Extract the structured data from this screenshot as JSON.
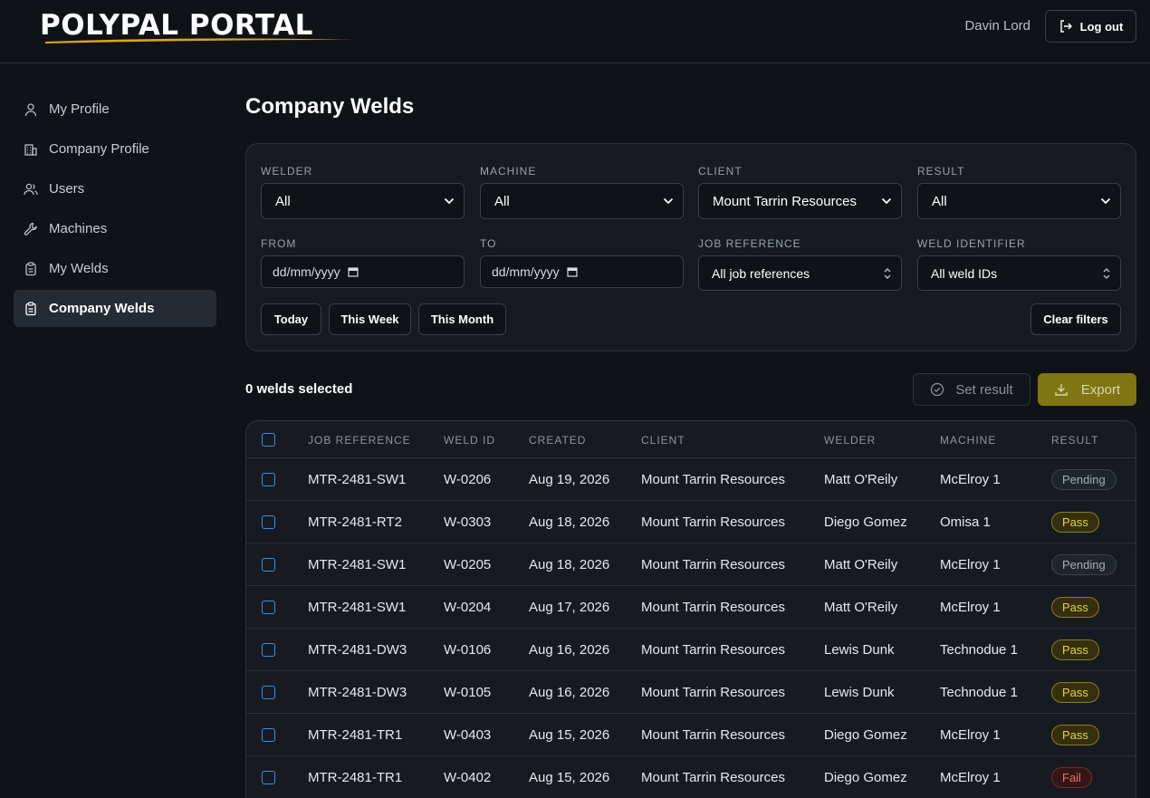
{
  "header": {
    "logo_text": "POLYPAL PORTAL",
    "user_name": "Davin Lord",
    "logout_label": "Log out"
  },
  "sidebar": {
    "items": [
      {
        "label": "My Profile",
        "icon": "user-icon",
        "active": false
      },
      {
        "label": "Company Profile",
        "icon": "building-icon",
        "active": false
      },
      {
        "label": "Users",
        "icon": "users-icon",
        "active": false
      },
      {
        "label": "Machines",
        "icon": "wrench-icon",
        "active": false
      },
      {
        "label": "My Welds",
        "icon": "clipboard-icon",
        "active": false
      },
      {
        "label": "Company Welds",
        "icon": "clipboard-icon",
        "active": true
      }
    ]
  },
  "page": {
    "title": "Company Welds"
  },
  "filters": {
    "welder": {
      "label": "WELDER",
      "value": "All"
    },
    "machine": {
      "label": "MACHINE",
      "value": "All"
    },
    "client": {
      "label": "CLIENT",
      "value": "Mount Tarrin Resources"
    },
    "result": {
      "label": "RESULT",
      "value": "All"
    },
    "from": {
      "label": "FROM",
      "placeholder": "dd/mm/yyyy"
    },
    "to": {
      "label": "TO",
      "placeholder": "dd/mm/yyyy"
    },
    "job_reference": {
      "label": "JOB REFERENCE",
      "value": "All job references"
    },
    "weld_identifier": {
      "label": "WELD IDENTIFIER",
      "value": "All weld IDs"
    },
    "quick": {
      "today": "Today",
      "this_week": "This Week",
      "this_month": "This Month"
    },
    "clear_label": "Clear filters"
  },
  "toolbar": {
    "selection_count": "0 welds selected",
    "set_result_label": "Set result",
    "export_label": "Export"
  },
  "table": {
    "columns": [
      "JOB REFERENCE",
      "WELD ID",
      "CREATED",
      "CLIENT",
      "WELDER",
      "MACHINE",
      "RESULT"
    ],
    "rows": [
      {
        "job": "MTR-2481-SW1",
        "weld": "W-0206",
        "created": "Aug 19, 2026",
        "client": "Mount Tarrin Resources",
        "welder": "Matt O'Reily",
        "machine": "McElroy 1",
        "result": "Pending"
      },
      {
        "job": "MTR-2481-RT2",
        "weld": "W-0303",
        "created": "Aug 18, 2026",
        "client": "Mount Tarrin Resources",
        "welder": "Diego Gomez",
        "machine": "Omisa 1",
        "result": "Pass"
      },
      {
        "job": "MTR-2481-SW1",
        "weld": "W-0205",
        "created": "Aug 18, 2026",
        "client": "Mount Tarrin Resources",
        "welder": "Matt O'Reily",
        "machine": "McElroy 1",
        "result": "Pending"
      },
      {
        "job": "MTR-2481-SW1",
        "weld": "W-0204",
        "created": "Aug 17, 2026",
        "client": "Mount Tarrin Resources",
        "welder": "Matt O'Reily",
        "machine": "McElroy 1",
        "result": "Pass"
      },
      {
        "job": "MTR-2481-DW3",
        "weld": "W-0106",
        "created": "Aug 16, 2026",
        "client": "Mount Tarrin Resources",
        "welder": "Lewis Dunk",
        "machine": "Technodue 1",
        "result": "Pass"
      },
      {
        "job": "MTR-2481-DW3",
        "weld": "W-0105",
        "created": "Aug 16, 2026",
        "client": "Mount Tarrin Resources",
        "welder": "Lewis Dunk",
        "machine": "Technodue 1",
        "result": "Pass"
      },
      {
        "job": "MTR-2481-TR1",
        "weld": "W-0403",
        "created": "Aug 15, 2026",
        "client": "Mount Tarrin Resources",
        "welder": "Diego Gomez",
        "machine": "McElroy 1",
        "result": "Pass"
      },
      {
        "job": "MTR-2481-TR1",
        "weld": "W-0402",
        "created": "Aug 15, 2026",
        "client": "Mount Tarrin Resources",
        "welder": "Diego Gomez",
        "machine": "McElroy 1",
        "result": "Fail"
      }
    ]
  },
  "colors": {
    "background": "#0f1216",
    "panel": "#171b21",
    "accent_export": "#7f7513",
    "pass": "#e7d43a",
    "fail": "#f07070",
    "checkbox": "#3d8ee8"
  }
}
